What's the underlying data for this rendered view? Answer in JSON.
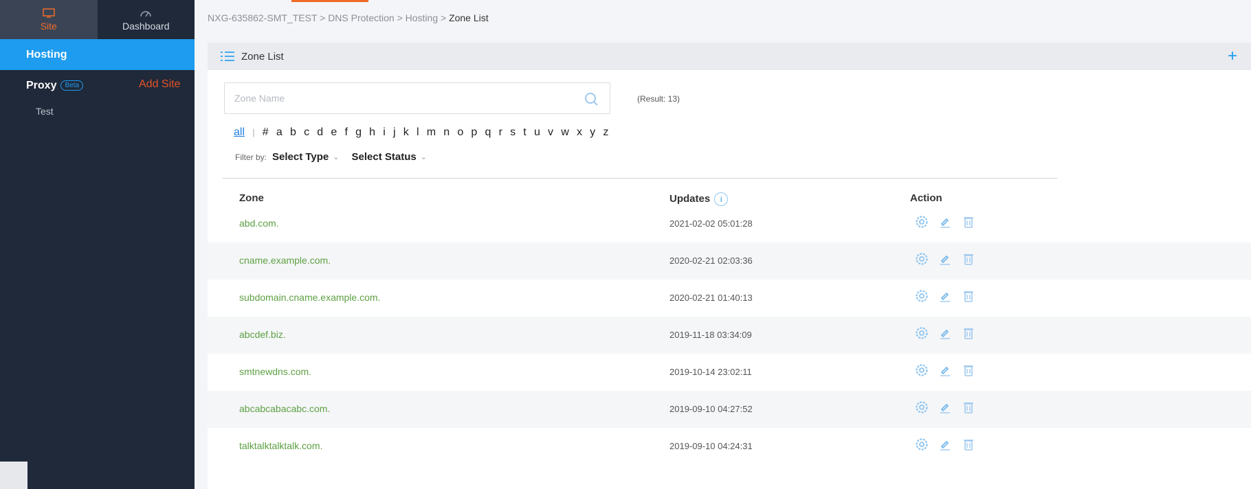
{
  "sidebar": {
    "tab_site": "Site",
    "tab_dashboard": "Dashboard",
    "hosting": "Hosting",
    "proxy": "Proxy",
    "beta": "Beta",
    "add_site": "Add Site",
    "sub_item": "Test"
  },
  "breadcrumb": {
    "path": "NXG-635862-SMT_TEST > DNS Protection > Hosting > ",
    "current": "Zone List"
  },
  "panel": {
    "title": "Zone List",
    "add": "+"
  },
  "search": {
    "placeholder": "Zone Name",
    "value": ""
  },
  "result": "(Result: 13)",
  "alphabet": {
    "all": "all",
    "separator": "|",
    "letters": [
      "#",
      "a",
      "b",
      "c",
      "d",
      "e",
      "f",
      "g",
      "h",
      "i",
      "j",
      "k",
      "l",
      "m",
      "n",
      "o",
      "p",
      "q",
      "r",
      "s",
      "t",
      "u",
      "v",
      "w",
      "x",
      "y",
      "z"
    ]
  },
  "filter": {
    "label": "Filter by:",
    "type": "Select Type",
    "status": "Select Status"
  },
  "table": {
    "columns": {
      "zone": "Zone",
      "updates": "Updates",
      "action": "Action"
    },
    "info_glyph": "i",
    "rows": [
      {
        "zone": "abd.com.",
        "updated": "2021-02-02 05:01:28"
      },
      {
        "zone": "cname.example.com.",
        "updated": "2020-02-21 02:03:36"
      },
      {
        "zone": "subdomain.cname.example.com.",
        "updated": "2020-02-21 01:40:13"
      },
      {
        "zone": "abcdef.biz.",
        "updated": "2019-11-18 03:34:09"
      },
      {
        "zone": "smtnewdns.com.",
        "updated": "2019-10-14 23:02:11"
      },
      {
        "zone": "abcabcabacabc.com.",
        "updated": "2019-09-10 04:27:52"
      },
      {
        "zone": "talktalktalktalk.com.",
        "updated": "2019-09-10 04:24:31"
      }
    ]
  },
  "icons": {
    "site": "monitor-icon",
    "dashboard": "gauge-icon",
    "list": "list-icon",
    "search": "search-icon",
    "info": "info-icon",
    "settings": "gear-icon",
    "edit": "edit-icon",
    "delete": "trash-icon"
  },
  "colors": {
    "sidebar_bg": "#1f2939",
    "active_blue": "#1e9cf0",
    "accent_orange": "#ee6b29",
    "zone_green": "#5da043"
  }
}
